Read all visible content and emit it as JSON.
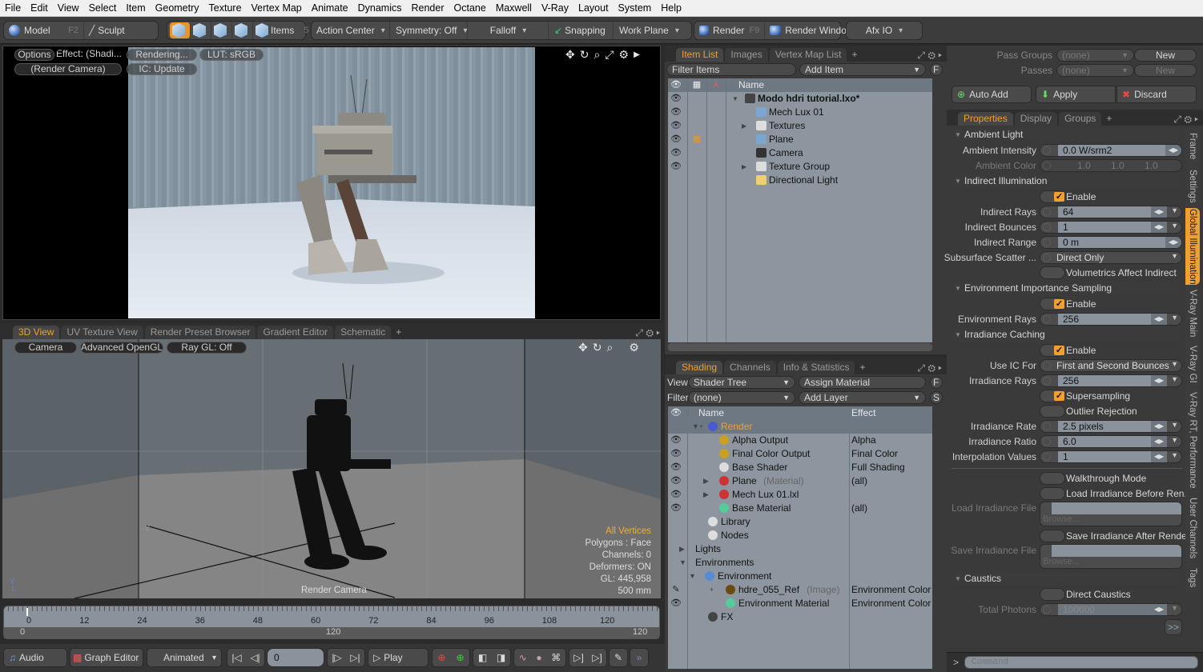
{
  "menu": [
    "File",
    "Edit",
    "View",
    "Select",
    "Item",
    "Geometry",
    "Texture",
    "Vertex Map",
    "Animate",
    "Dynamics",
    "Render",
    "Octane",
    "Maxwell",
    "V-Ray",
    "Layout",
    "System",
    "Help"
  ],
  "toolbar": {
    "model": "Model",
    "model_key": "F2",
    "sculpt": "Sculpt",
    "items": "Items",
    "items_key": "5",
    "action_center": "Action Center",
    "symmetry": "Symmetry: Off",
    "falloff": "Falloff",
    "snapping": "Snapping",
    "work_plane": "Work Plane",
    "render": "Render",
    "render_key": "F9",
    "render_window": "Render Window",
    "afx": "Afx IO"
  },
  "render_view": {
    "options": "Options",
    "effect": "Effect: (Shadi...",
    "rendering": "Rendering...",
    "lut": "LUT: sRGB",
    "camera": "(Render Camera)",
    "ic": "IC: Update"
  },
  "view3d": {
    "tabs": [
      "3D View",
      "UV Texture View",
      "Render Preset Browser",
      "Gradient Editor",
      "Schematic"
    ],
    "camera": "Camera",
    "shading": "Advanced OpenGL",
    "raygl": "Ray GL: Off",
    "stats": {
      "selection": "All Vertices",
      "polygons": "Polygons : Face",
      "channels": "Channels: 0",
      "deformers": "Deformers: ON",
      "gl": "GL: 445,958",
      "scale": "500 mm"
    },
    "camera_label": "Render Camera",
    "axis_z": "-Z",
    "axis_x": "+X"
  },
  "timeline": {
    "ticks": [
      "0",
      "12",
      "24",
      "36",
      "48",
      "60",
      "72",
      "84",
      "96",
      "108",
      "120"
    ],
    "range_start": "0",
    "range_mid": "120",
    "range_end": "120"
  },
  "bottom": {
    "audio": "Audio",
    "graph_editor": "Graph Editor",
    "mode": "Animated",
    "frame": "0",
    "play": "Play"
  },
  "item_list": {
    "tabs": [
      "Item List",
      "Images",
      "Vertex Map List"
    ],
    "filter": "Filter Items",
    "add_item": "Add Item",
    "f_btn": "F",
    "name_col": "Name",
    "items": [
      {
        "label": "Modo hdri tutorial.lxo*",
        "bold": true,
        "indent": 0
      },
      {
        "label": "Mech Lux 01",
        "indent": 1
      },
      {
        "label": "Textures",
        "indent": 1
      },
      {
        "label": "Plane",
        "indent": 1
      },
      {
        "label": "Camera",
        "indent": 1
      },
      {
        "label": "Texture Group",
        "indent": 1
      },
      {
        "label": "Directional Light",
        "indent": 1
      }
    ]
  },
  "shading": {
    "tabs": [
      "Shading",
      "Channels",
      "Info & Statistics"
    ],
    "view_label": "View",
    "view_value": "Shader Tree",
    "assign": "Assign Material",
    "f_btn": "F",
    "filter_label": "Filter",
    "filter_value": "(none)",
    "add_layer": "Add Layer",
    "s_btn": "S",
    "cols": [
      "Name",
      "Effect"
    ],
    "rows": [
      {
        "name": "Render",
        "effect": "",
        "hint": ""
      },
      {
        "name": "Alpha Output",
        "effect": "Alpha",
        "hint": ""
      },
      {
        "name": "Final Color Output",
        "effect": "Final Color",
        "hint": ""
      },
      {
        "name": "Base Shader",
        "effect": "Full Shading",
        "hint": ""
      },
      {
        "name": "Plane",
        "effect": "(all)",
        "hint": "(Material)"
      },
      {
        "name": "Mech Lux 01.lxl",
        "effect": "",
        "hint": ""
      },
      {
        "name": "Base Material",
        "effect": "(all)",
        "hint": ""
      },
      {
        "name": "Library",
        "effect": "",
        "hint": ""
      },
      {
        "name": "Nodes",
        "effect": "",
        "hint": ""
      },
      {
        "name": "Lights",
        "effect": "",
        "hint": ""
      },
      {
        "name": "Environments",
        "effect": "",
        "hint": ""
      },
      {
        "name": "Environment",
        "effect": "",
        "hint": ""
      },
      {
        "name": "hdre_055_Ref",
        "effect": "Environment Color",
        "hint": "(Image)"
      },
      {
        "name": "Environment Material",
        "effect": "Environment Color",
        "hint": ""
      },
      {
        "name": "FX",
        "effect": "",
        "hint": ""
      }
    ]
  },
  "passes": {
    "pass_groups_label": "Pass Groups",
    "pass_groups_value": "(none)",
    "new": "New",
    "passes_label": "Passes",
    "passes_value": "(none)",
    "auto_add": "Auto Add",
    "apply": "Apply",
    "discard": "Discard"
  },
  "properties": {
    "tabs": [
      "Properties",
      "Display",
      "Groups"
    ],
    "side_tabs": [
      "Frame",
      "Settings",
      "Global Illumination",
      "V-Ray Main",
      "V-Ray GI",
      "V-Ray RT, Performance",
      "User Channels",
      "Tags"
    ],
    "ambient_light": "Ambient Light",
    "ambient_intensity_label": "Ambient Intensity",
    "ambient_intensity": "0.0 W/srm2",
    "ambient_color_label": "Ambient Color",
    "ambient_color": [
      "1.0",
      "1.0",
      "1.0"
    ],
    "indirect": "Indirect Illumination",
    "enable": "Enable",
    "indirect_rays_label": "Indirect Rays",
    "indirect_rays": "64",
    "indirect_bounces_label": "Indirect Bounces",
    "indirect_bounces": "1",
    "indirect_range_label": "Indirect Range",
    "indirect_range": "0 m",
    "subsurface_label": "Subsurface Scatter ...",
    "subsurface": "Direct Only",
    "volumetrics": "Volumetrics Affect Indirect",
    "env_sampling": "Environment Importance Sampling",
    "env_rays_label": "Environment Rays",
    "env_rays": "256",
    "irradiance_caching": "Irradiance Caching",
    "use_ic_label": "Use IC For",
    "use_ic": "First and Second Bounces",
    "irr_rays_label": "Irradiance Rays",
    "irr_rays": "256",
    "supersampling": "Supersampling",
    "outlier": "Outlier Rejection",
    "irr_rate_label": "Irradiance Rate",
    "irr_rate": "2.5 pixels",
    "irr_ratio_label": "Irradiance Ratio",
    "irr_ratio": "6.0",
    "interp_label": "Interpolation Values",
    "interp": "1",
    "walkthrough": "Walkthrough Mode",
    "load_before": "Load Irradiance Before Ren...",
    "load_file_label": "Load Irradiance File",
    "browse": "Browse...",
    "save_after": "Save Irradiance After Render",
    "save_file_label": "Save Irradiance File",
    "caustics": "Caustics",
    "direct_caustics": "Direct Caustics",
    "total_photons_label": "Total Photons",
    "total_photons": "100000",
    "more": ">>"
  },
  "command": {
    "prompt": ">",
    "placeholder": "Command"
  },
  "colors": {
    "accent": "#f0a030",
    "list_bg": "#8d969f"
  }
}
